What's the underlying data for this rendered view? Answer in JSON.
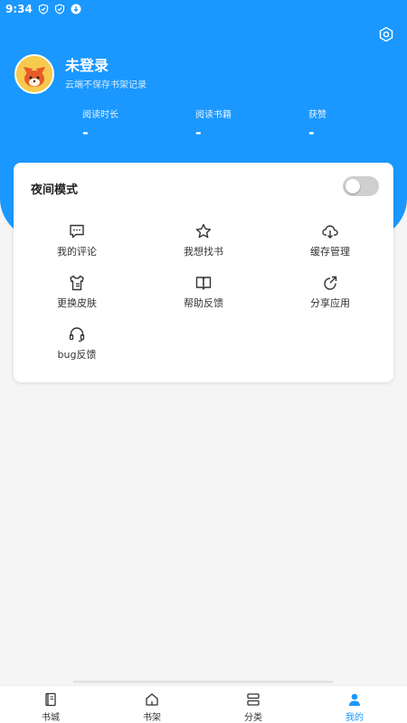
{
  "status_bar": {
    "time": "9:34"
  },
  "profile": {
    "name": "未登录",
    "subtitle": "云端不保存书架记录",
    "stats": [
      {
        "label": "阅读时长",
        "value": "-"
      },
      {
        "label": "阅读书籍",
        "value": "-"
      },
      {
        "label": "获赞",
        "value": "-"
      }
    ]
  },
  "settings": {
    "night_mode_label": "夜间模式",
    "night_mode_on": false
  },
  "menu": [
    {
      "label": "我的评论",
      "icon": "comment-icon"
    },
    {
      "label": "我想找书",
      "icon": "star-icon"
    },
    {
      "label": "缓存管理",
      "icon": "cloud-download-icon"
    },
    {
      "label": "更换皮肤",
      "icon": "shirt-icon"
    },
    {
      "label": "帮助反馈",
      "icon": "help-book-icon"
    },
    {
      "label": "分享应用",
      "icon": "share-icon"
    },
    {
      "label": "bug反馈",
      "icon": "headset-icon"
    }
  ],
  "bottom_nav": [
    {
      "label": "书城",
      "icon": "book-icon",
      "active": false
    },
    {
      "label": "书架",
      "icon": "home-icon",
      "active": false
    },
    {
      "label": "分类",
      "icon": "category-icon",
      "active": false
    },
    {
      "label": "我的",
      "icon": "user-icon",
      "active": true
    }
  ],
  "colors": {
    "accent": "#1a98ff",
    "toggle_off": "#cfcfcf"
  }
}
